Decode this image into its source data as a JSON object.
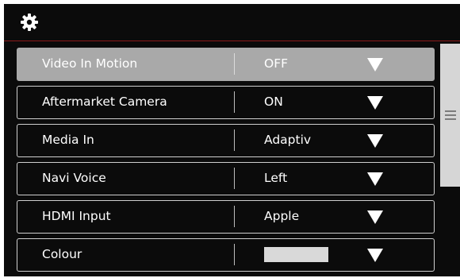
{
  "header": {
    "icon": "gear-icon"
  },
  "settings": {
    "rows": [
      {
        "label": "Video In Motion",
        "value": "OFF",
        "selected": true
      },
      {
        "label": "Aftermarket Camera",
        "value": "ON",
        "selected": false
      },
      {
        "label": "Media In",
        "value": "Adaptiv",
        "selected": false
      },
      {
        "label": "Navi Voice",
        "value": "Left",
        "selected": false
      },
      {
        "label": "HDMI Input",
        "value": "Apple",
        "selected": false
      },
      {
        "label": "Colour",
        "value": "",
        "swatch_color": "#d9d9d9",
        "selected": false
      }
    ]
  },
  "scrollbar": {
    "thumb_icon": "grip-lines-icon",
    "scroll_fraction": 0.0
  },
  "colors": {
    "background": "#0b0b0b",
    "header_border": "#8a1a1a",
    "row_border": "#cfcfcf",
    "selected_row": "#a9a9a9",
    "text": "#ffffff",
    "scroll_thumb": "#d6d6d6"
  }
}
